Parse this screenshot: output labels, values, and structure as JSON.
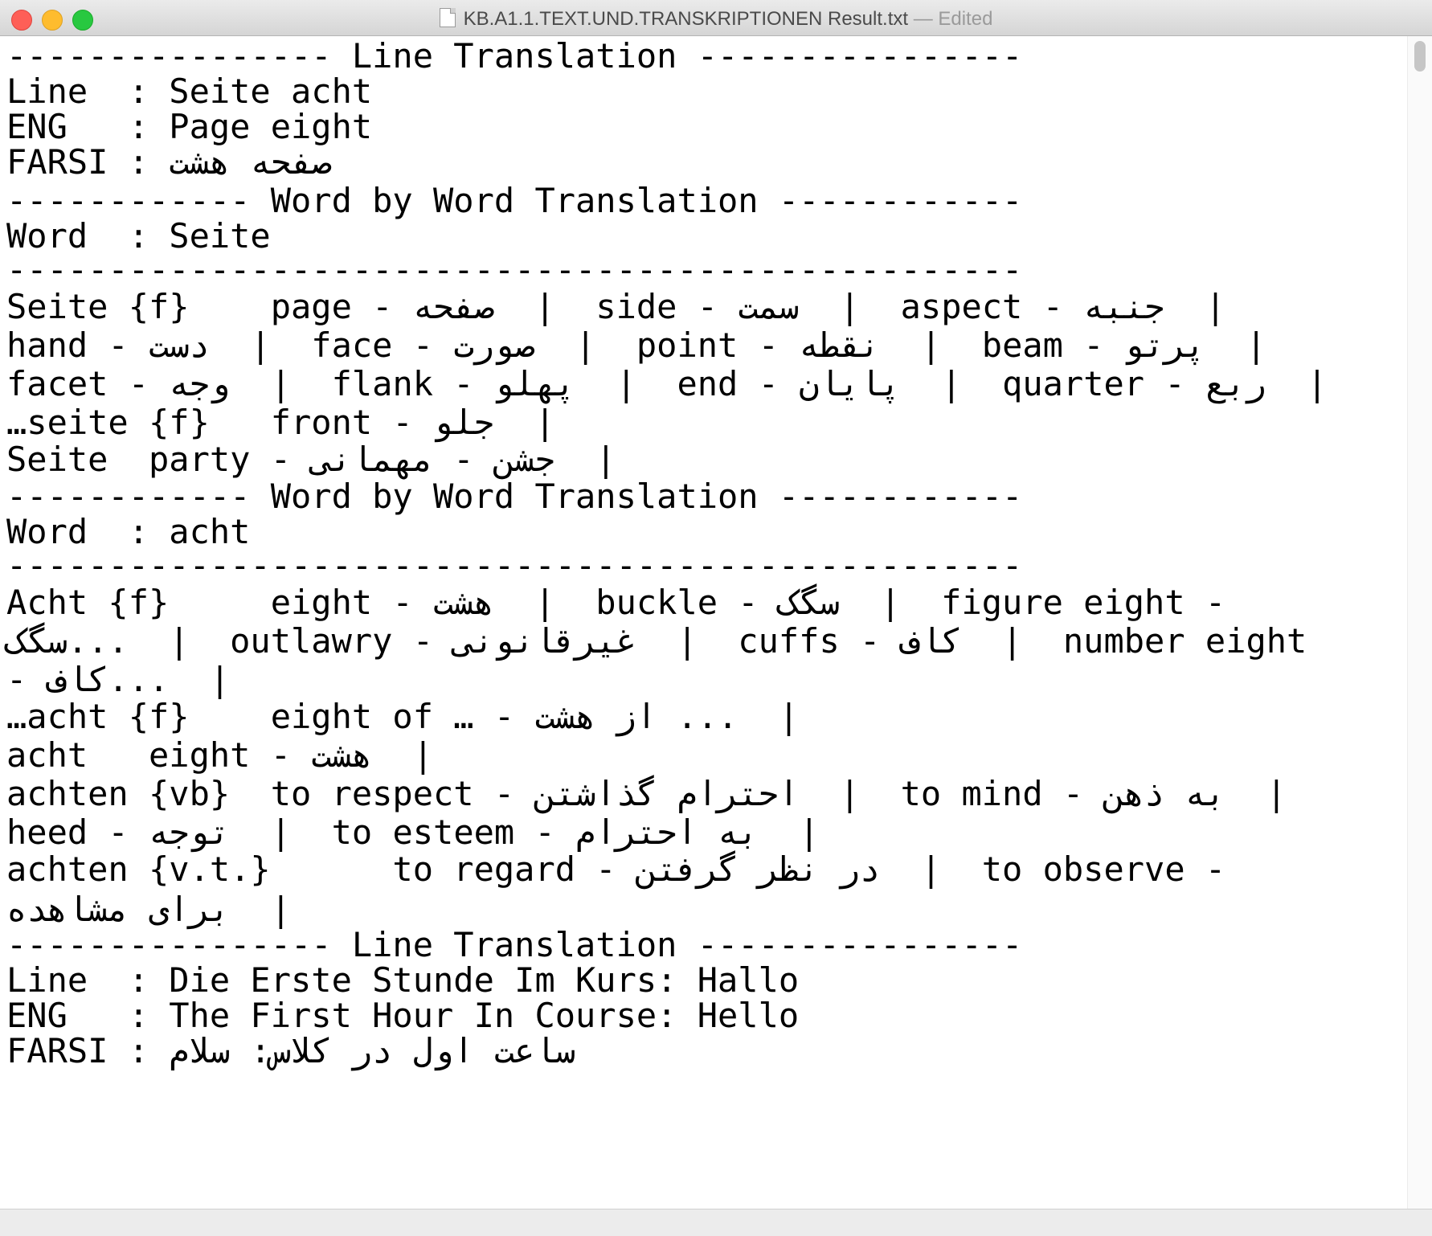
{
  "window": {
    "title": "KB.A1.1.TEXT.UND.TRANSKRIPTIONEN Result.txt",
    "status": "— Edited"
  },
  "document": {
    "lines": [
      "---------------- Line Translation ----------------",
      "Line  : Seite acht",
      "ENG   : Page eight",
      "FARSI : صفحه هشت",
      "------------ Word by Word Translation ------------",
      "Word  : Seite",
      "--------------------------------------------------",
      "Seite {f}    page - صفحه  |  side - سمت  |  aspect - جنبه  |",
      "hand - دست  |  face - صورت  |  point - نقطه  |  beam - پرتو  |",
      "facet - وجه  |  flank - پهلو  |  end - پایان  |  quarter - ربع  |",
      "…seite {f}   front - جلو  |",
      "Seite  party - جشن - مهمانی  |",
      "------------ Word by Word Translation ------------",
      "Word  : acht",
      "--------------------------------------------------",
      "Acht {f}     eight - هشت  |  buckle - سگک  |  figure eight -",
      "سگک...  |  outlawry - غیرقانونی  |  cuffs - کاف  |  number eight",
      "- کاف...  |",
      "…acht {f}    eight of … - از هشت ...  |",
      "acht   eight - هشت  |",
      "achten {vb}  to respect - احترام گذاشتن  |  to mind - به ذهن  |",
      "heed - توجه  |  to esteem - به احترام  |",
      "achten {v.t.}      to regard - در نظر گرفتن  |  to observe -",
      "برای مشاهده  |",
      "---------------- Line Translation ----------------",
      "Line  : Die Erste Stunde Im Kurs: Hallo",
      "ENG   : The First Hour In Course: Hello",
      "FARSI : ساعت اول در کلاس: سلام"
    ]
  }
}
